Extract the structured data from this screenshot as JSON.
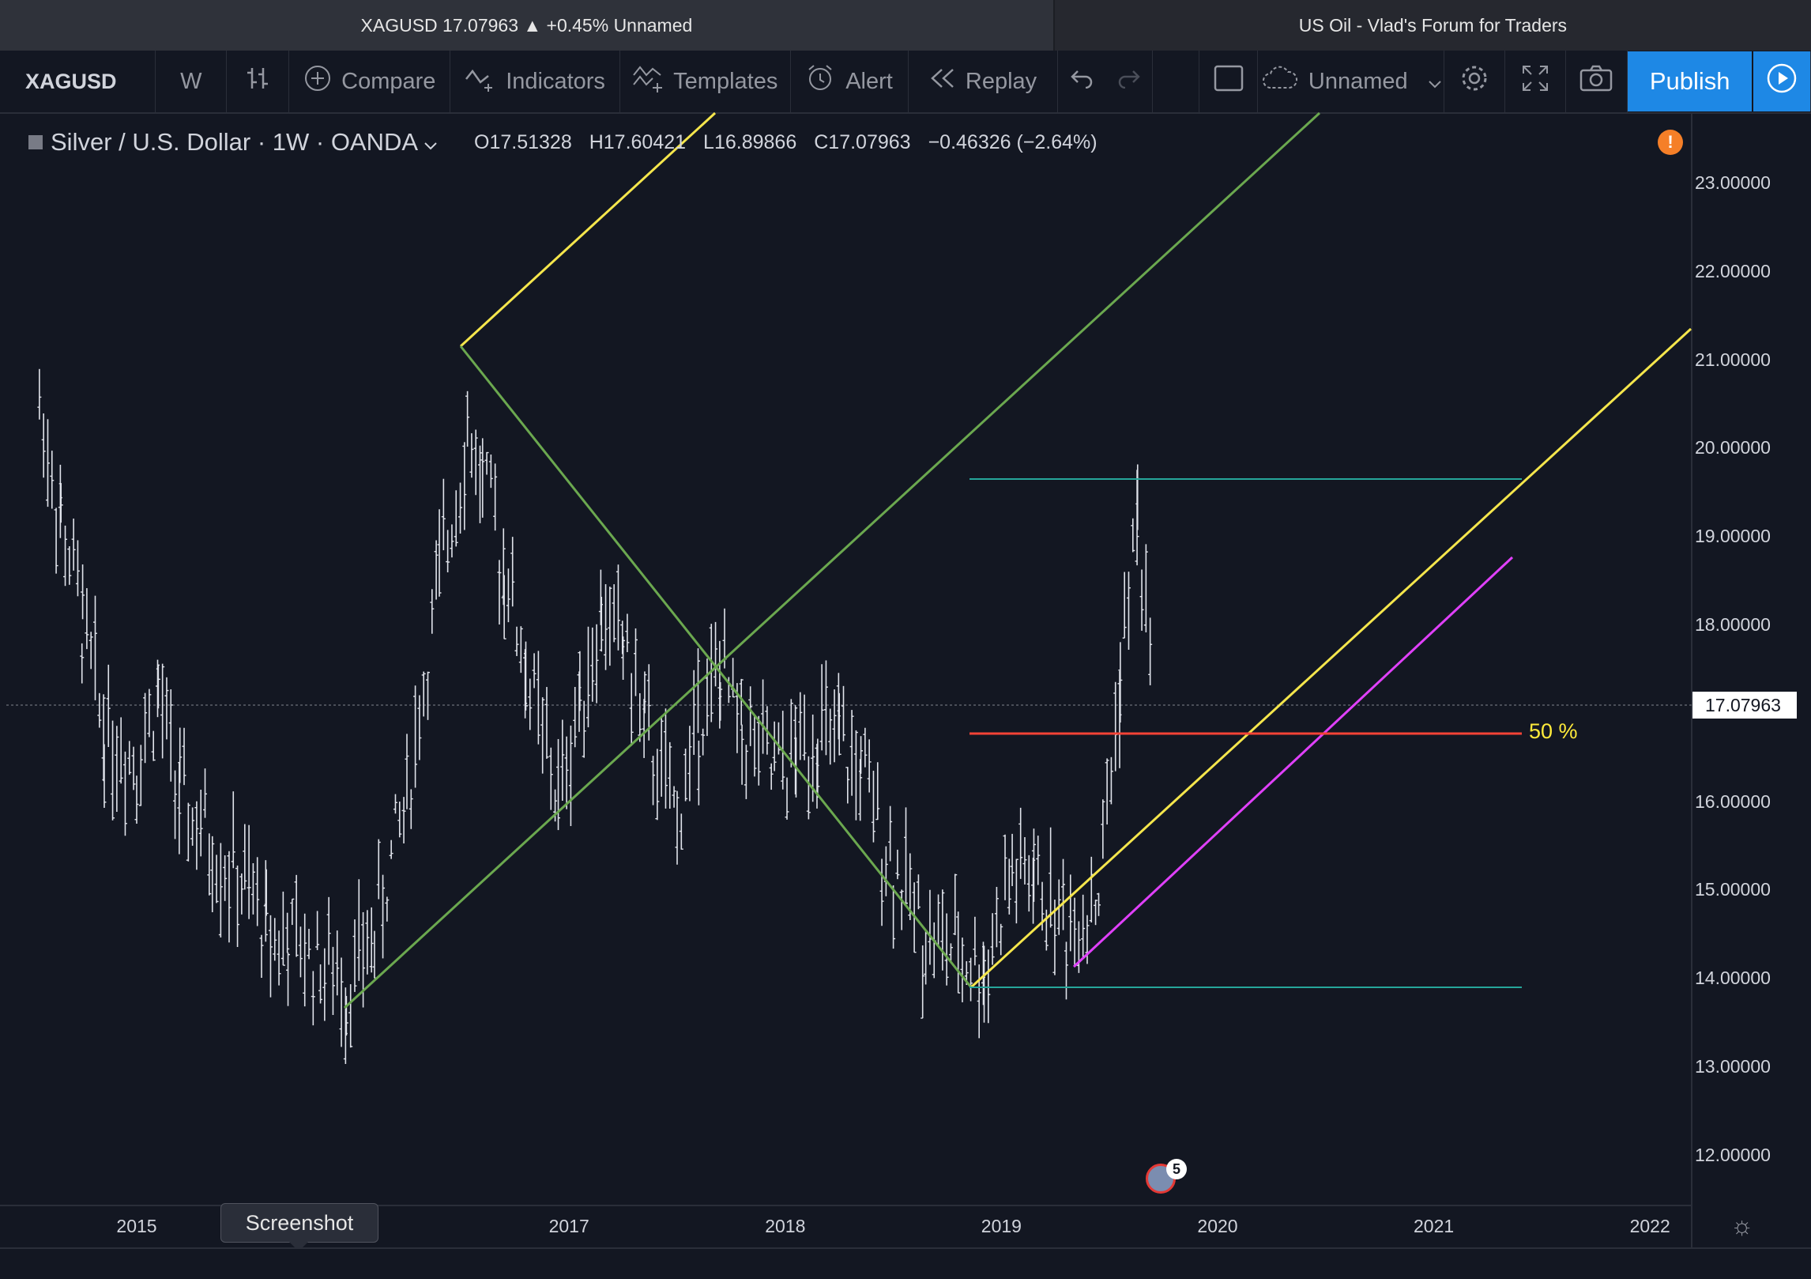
{
  "tabs": {
    "active": "XAGUSD 17.07963 ▲ +0.45% Unnamed",
    "inactive": "US Oil - Vlad's Forum for Traders"
  },
  "toolbar": {
    "symbol": "XAGUSD",
    "interval": "W",
    "compare": "Compare",
    "indicators": "Indicators",
    "templates": "Templates",
    "alert": "Alert",
    "replay": "Replay",
    "layout_name": "Unnamed",
    "publish": "Publish"
  },
  "legend": {
    "title": "Silver / U.S. Dollar · 1W · OANDA",
    "open": "O17.51328",
    "high": "H17.60421",
    "low": "L16.89866",
    "close": "C17.07963",
    "change": "−0.46326 (−2.64%)"
  },
  "price_axis": {
    "last_price": "17.07963",
    "labels": [
      "23.00000",
      "22.00000",
      "21.00000",
      "20.00000",
      "19.00000",
      "18.00000",
      "16.00000",
      "15.00000",
      "14.00000",
      "13.00000",
      "12.00000"
    ]
  },
  "time_axis": {
    "labels": [
      "2015",
      "2017",
      "2018",
      "2019",
      "2020",
      "2021",
      "2022"
    ]
  },
  "drawings": {
    "fib_label": "50 %"
  },
  "tooltip": "Screenshot",
  "events_count": "5",
  "colors": {
    "background": "#131722",
    "green_pitchfork": "#6ba84f",
    "yellow_line": "#f5e64c",
    "magenta_line": "#e040fb",
    "teal_line": "#26a69a",
    "red_line": "#f44336",
    "publish": "#1e88e5"
  },
  "chart_data": {
    "type": "ohlc",
    "symbol": "XAGUSD",
    "interval": "1W",
    "ylim": [
      11.5,
      23.5
    ],
    "x": [
      2014.55,
      2014.65,
      2014.75,
      2014.85,
      2015.0,
      2015.1,
      2015.2,
      2015.35,
      2015.5,
      2015.6,
      2015.7,
      2015.85,
      2015.97,
      2016.1,
      2016.25,
      2016.4,
      2016.53,
      2016.6,
      2016.7,
      2016.8,
      2016.95,
      2017.05,
      2017.15,
      2017.25,
      2017.35,
      2017.5,
      2017.6,
      2017.7,
      2017.8,
      2017.95,
      2018.05,
      2018.15,
      2018.25,
      2018.35,
      2018.5,
      2018.65,
      2018.8,
      2018.92,
      2019.05,
      2019.15,
      2019.3,
      2019.45,
      2019.55,
      2019.63,
      2019.7
    ],
    "close": [
      20.5,
      19.2,
      18.0,
      16.8,
      16.5,
      17.2,
      16.0,
      15.5,
      15.0,
      14.6,
      14.4,
      14.2,
      13.9,
      14.5,
      16.1,
      18.5,
      20.2,
      19.6,
      18.7,
      17.5,
      16.0,
      17.2,
      18.1,
      17.8,
      16.8,
      15.8,
      17.0,
      17.4,
      16.8,
      16.3,
      16.5,
      16.8,
      16.6,
      16.3,
      15.3,
      14.5,
      14.3,
      14.1,
      15.2,
      15.1,
      14.6,
      15.0,
      17.4,
      19.3,
      17.08
    ]
  }
}
